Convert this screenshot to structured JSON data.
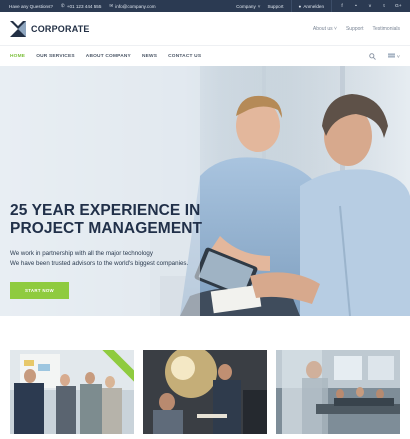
{
  "topbar": {
    "question": "Have any Questions?",
    "phone": "+01 123 444 555",
    "email": "info@company.com",
    "company_menu": "Company",
    "support": "Support",
    "login": "Anmelden",
    "social": [
      {
        "icon": "facebook-icon",
        "glyph": "f"
      },
      {
        "icon": "twitter-icon",
        "glyph": "•"
      },
      {
        "icon": "vimeo-icon",
        "glyph": "v"
      },
      {
        "icon": "tumblr-icon",
        "glyph": "t"
      },
      {
        "icon": "google-plus-icon",
        "glyph": "G+"
      }
    ]
  },
  "header": {
    "brand": "CORPORATE",
    "about_us": "About us",
    "support": "Support",
    "testimonials": "Testimonials"
  },
  "nav": {
    "items": [
      "HOME",
      "OUR SERVICES",
      "ABOUT COMPANY",
      "NEWS",
      "CONTACT US"
    ],
    "active_index": 0
  },
  "hero": {
    "title_line1": "25 YEAR EXPERIENCE IN",
    "title_line2": "PROJECT MANAGEMENT",
    "text_line1": "We work in partnership with all the major technology",
    "text_line2": "We have been trusted advisors to the world's biggest companies.",
    "button": "START NOW"
  },
  "colors": {
    "accent": "#8fcb3f",
    "dark": "#2b3a52",
    "title": "#213049"
  }
}
